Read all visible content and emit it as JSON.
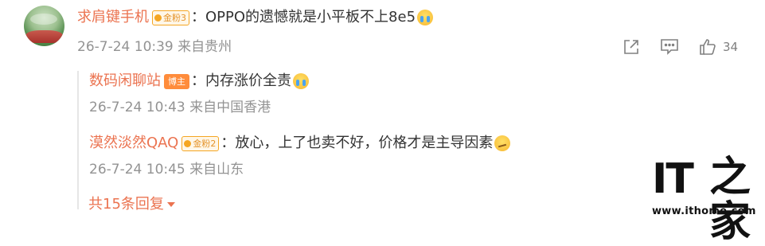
{
  "main_comment": {
    "username": "求肩键手机",
    "badge": "金粉3",
    "colon": "：",
    "text": "OPPO的遗憾就是小平板不上8e5",
    "timestamp": "26-7-24 10:39",
    "location": "来自贵州",
    "like_count": "34"
  },
  "replies": [
    {
      "username": "数码闲聊站",
      "badge": "博主",
      "colon": "：",
      "text": "内存涨价全责",
      "timestamp": "26-7-24 10:43",
      "location": "来自中国香港"
    },
    {
      "username": "漠然淡然QAQ",
      "badge": "金粉2",
      "colon": "：",
      "text": "放心，上了也卖不好，价格才是主导因素",
      "timestamp": "26-7-24 10:45",
      "location": "来自山东"
    }
  ],
  "more_replies": "共15条回复",
  "watermark": {
    "logo_it": "IT",
    "logo_home": "之家",
    "url": "www.ithome.com"
  },
  "colors": {
    "username": "#eb7350",
    "meta": "#939393",
    "text": "#333333"
  }
}
